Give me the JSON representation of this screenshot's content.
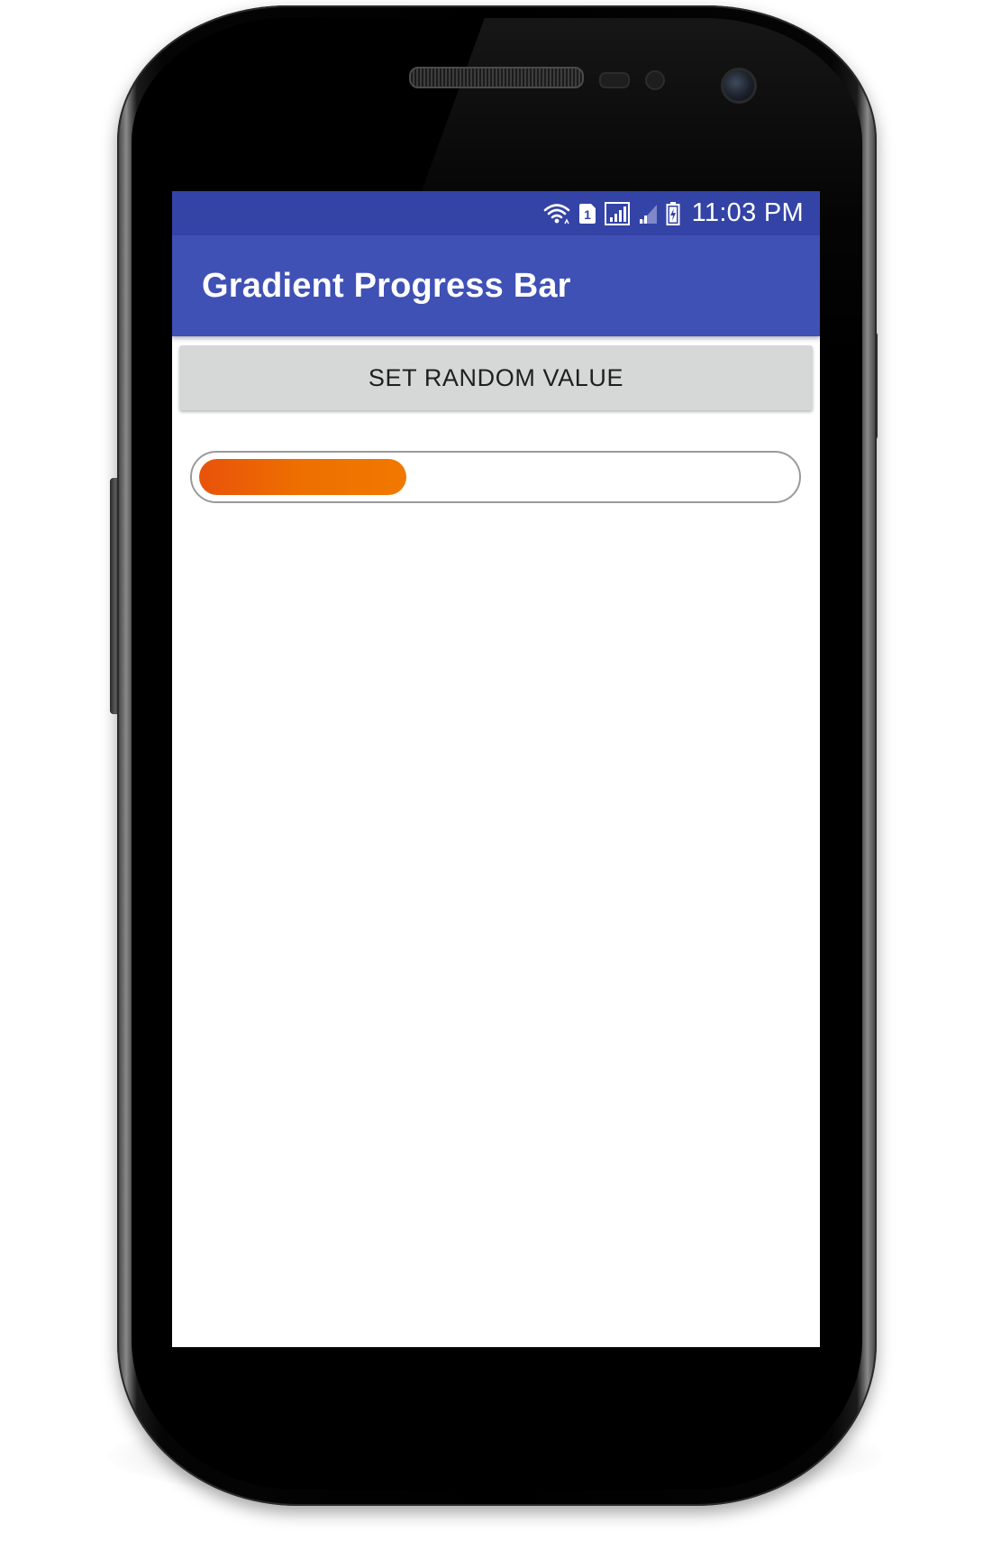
{
  "status_bar": {
    "time": "11:03 PM",
    "sim_slot": "1",
    "icons": [
      "wifi-icon",
      "sim-1-icon",
      "signal-full-icon",
      "signal-weak-icon",
      "battery-charging-icon"
    ],
    "background_color": "#3443a6"
  },
  "app_bar": {
    "title": "Gradient Progress Bar",
    "background_color": "#3f51b5"
  },
  "main": {
    "set_random_button_label": "SET RANDOM VALUE",
    "progress": {
      "value_fraction": 0.35,
      "gradient_colors": [
        "#e8530b",
        "#ee7000",
        "#f07800"
      ]
    }
  }
}
